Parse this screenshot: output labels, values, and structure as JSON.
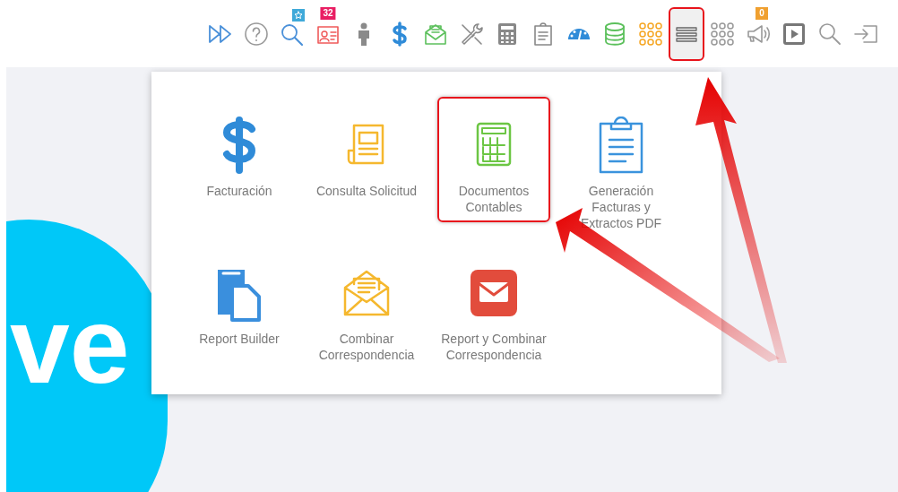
{
  "toolbar": {
    "items": [
      {
        "kind": "fast-forward",
        "selected": false
      },
      {
        "kind": "help",
        "selected": false
      },
      {
        "kind": "search-star",
        "selected": false
      },
      {
        "kind": "id-card",
        "badge": "32",
        "selected": false
      },
      {
        "kind": "person",
        "selected": false
      },
      {
        "kind": "dollar",
        "selected": false
      },
      {
        "kind": "envelope",
        "selected": false
      },
      {
        "kind": "tools",
        "selected": false
      },
      {
        "kind": "calculator",
        "selected": false
      },
      {
        "kind": "clipboard",
        "selected": false
      },
      {
        "kind": "gauge",
        "selected": false
      },
      {
        "kind": "database",
        "selected": false
      },
      {
        "kind": "dots-orange",
        "selected": false
      },
      {
        "kind": "menu",
        "selected": true,
        "highlighted": true
      },
      {
        "kind": "dots-gray",
        "selected": false
      },
      {
        "kind": "megaphone",
        "badge": "0",
        "selected": false
      },
      {
        "kind": "play",
        "selected": false
      },
      {
        "kind": "search",
        "selected": false
      },
      {
        "kind": "logout",
        "selected": false
      }
    ]
  },
  "menu": {
    "items": [
      {
        "kind": "dollar",
        "label": "Facturación",
        "highlighted": false
      },
      {
        "kind": "document",
        "label": "Consulta Solicitud",
        "highlighted": false
      },
      {
        "kind": "calculator",
        "label": "Documentos Contables",
        "highlighted": true
      },
      {
        "kind": "clipboard",
        "label": "Generación Facturas y Extractos PDF",
        "highlighted": false
      },
      {
        "kind": "report",
        "label": "Report Builder",
        "highlighted": false
      },
      {
        "kind": "envelope-open",
        "label": "Combinar Correspondencia",
        "highlighted": false
      },
      {
        "kind": "mail",
        "label": "Report y Combinar Correspondencia",
        "highlighted": false
      }
    ]
  },
  "background": {
    "logo_text": "ve"
  }
}
